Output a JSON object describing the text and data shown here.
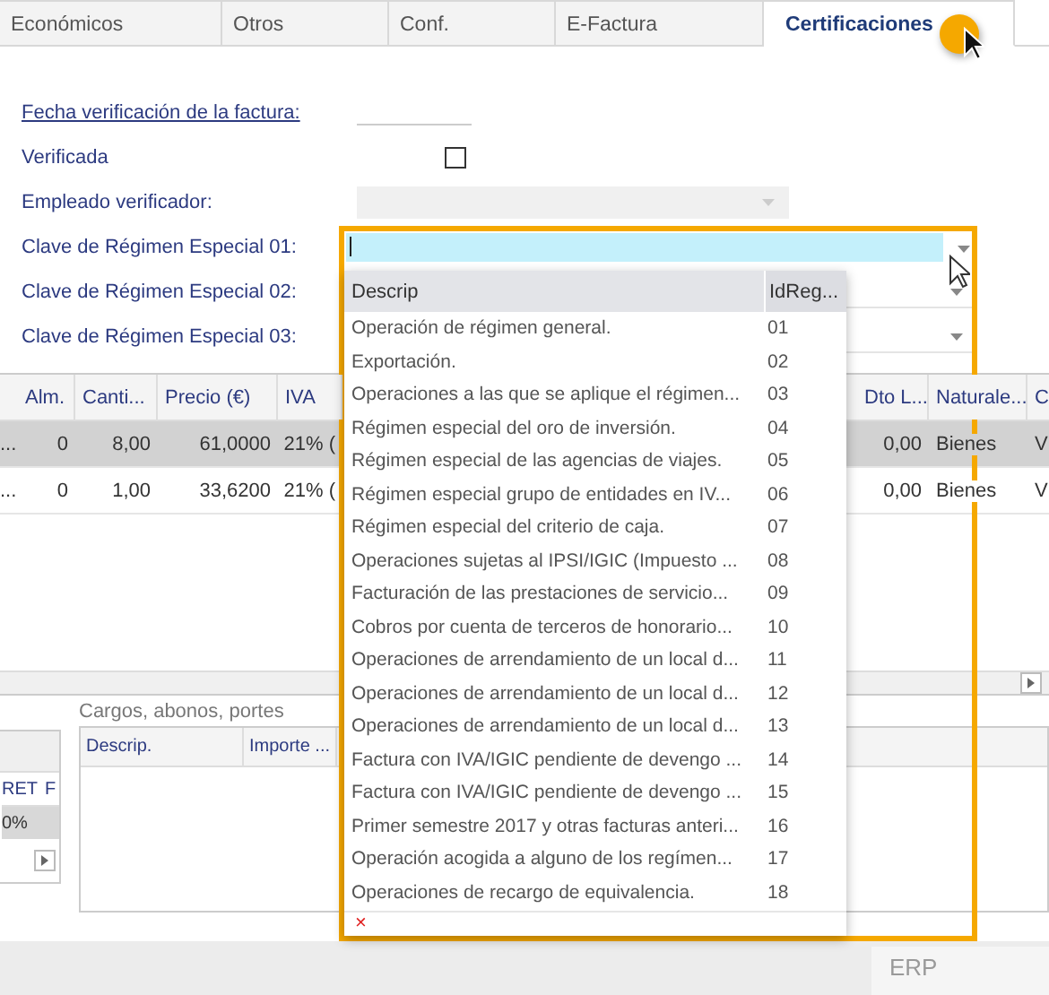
{
  "tabs": [
    {
      "label": "Económicos",
      "selected": false
    },
    {
      "label": "Otros",
      "selected": false
    },
    {
      "label": "Conf.",
      "selected": false
    },
    {
      "label": "E-Factura",
      "selected": false
    },
    {
      "label": "Certificaciones",
      "selected": true
    }
  ],
  "form": {
    "date_label": "Fecha verificación de la factura:",
    "verified_label": "Verificada",
    "verified_checked": false,
    "employee_label": "Empleado verificador:",
    "regime_keys": [
      {
        "label": "Clave de Régimen Especial 01:",
        "focused": true
      },
      {
        "label": "Clave de Régimen Especial 02:",
        "focused": false
      },
      {
        "label": "Clave de Régimen Especial 03:",
        "focused": false
      }
    ]
  },
  "lines_table": {
    "columns": [
      "Alm.",
      "Canti...",
      "Precio (€)",
      "IVA",
      "Dto L...",
      "Naturale...",
      "C"
    ],
    "rows": [
      {
        "lead": "...",
        "cells": [
          "0",
          "8,00",
          "61,0000",
          "21% (",
          "0,00",
          "Bienes",
          "V"
        ],
        "selected": true
      },
      {
        "lead": "...",
        "cells": [
          "0",
          "1,00",
          "33,6200",
          "21% (",
          "0,00",
          "Bienes",
          "V"
        ],
        "selected": false
      }
    ]
  },
  "left_grid": {
    "columns": [
      "RET",
      "F"
    ],
    "rows": [
      [
        "0%"
      ]
    ]
  },
  "charges": {
    "title": "Cargos, abonos, portes",
    "columns": [
      "Descrip.",
      "Importe ..."
    ]
  },
  "footer": {
    "app_label": "ERP"
  },
  "popup": {
    "columns": [
      "Descrip",
      "IdReg..."
    ],
    "items": [
      {
        "descrip": "Operación de régimen general.",
        "id": "01"
      },
      {
        "descrip": "Exportación.",
        "id": "02"
      },
      {
        "descrip": "Operaciones a las que se aplique el régimen...",
        "id": "03"
      },
      {
        "descrip": "Régimen especial del oro de inversión.",
        "id": "04"
      },
      {
        "descrip": "Régimen especial de las agencias de viajes.",
        "id": "05"
      },
      {
        "descrip": "Régimen especial grupo de entidades en IV...",
        "id": "06"
      },
      {
        "descrip": "Régimen especial del criterio de caja.",
        "id": "07"
      },
      {
        "descrip": "Operaciones sujetas al IPSI/IGIC (Impuesto ...",
        "id": "08"
      },
      {
        "descrip": "Facturación de las prestaciones de servicio...",
        "id": "09"
      },
      {
        "descrip": "Cobros por cuenta de terceros de honorario...",
        "id": "10"
      },
      {
        "descrip": "Operaciones de arrendamiento de un local d...",
        "id": "11"
      },
      {
        "descrip": "Operaciones de arrendamiento de un local d...",
        "id": "12"
      },
      {
        "descrip": "Operaciones de arrendamiento de un local d...",
        "id": "13"
      },
      {
        "descrip": "Factura con IVA/IGIC pendiente de devengo ...",
        "id": "14"
      },
      {
        "descrip": "Factura con IVA/IGIC pendiente de devengo ...",
        "id": "15"
      },
      {
        "descrip": "Primer semestre 2017 y otras facturas anteri...",
        "id": "16"
      },
      {
        "descrip": "Operación acogida a alguno de los regímen...",
        "id": "17"
      },
      {
        "descrip": "Operaciones de recargo de equivalencia.",
        "id": "18"
      }
    ],
    "clear_glyph": "×"
  }
}
